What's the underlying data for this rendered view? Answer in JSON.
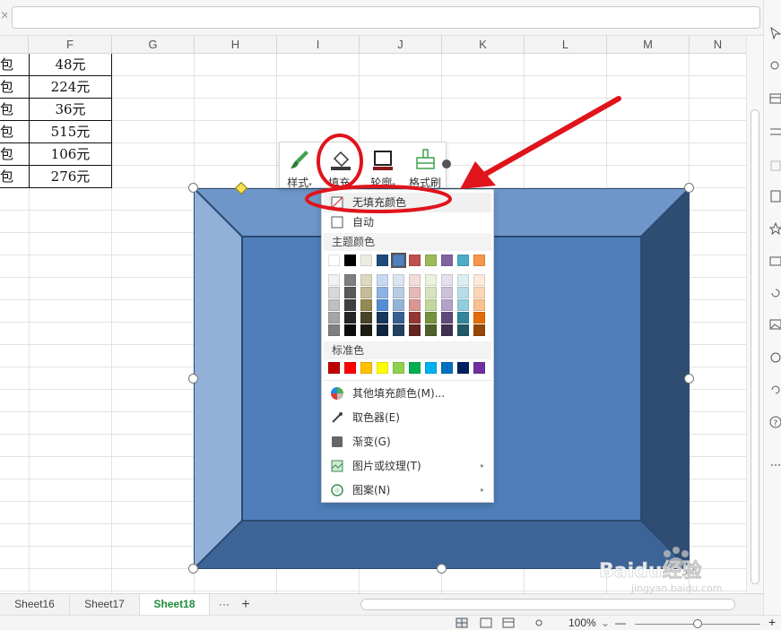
{
  "columns": [
    "F",
    "G",
    "H",
    "I",
    "J",
    "K",
    "L",
    "M",
    "N"
  ],
  "column_e_fragment": "包",
  "rows": [
    {
      "e": "包",
      "f": "48元"
    },
    {
      "e": "包",
      "f": "224元"
    },
    {
      "e": "包",
      "f": "36元"
    },
    {
      "e": "包",
      "f": "515元"
    },
    {
      "e": "包",
      "f": "106元"
    },
    {
      "e": "包",
      "f": "276元"
    }
  ],
  "shape_toolbar": {
    "style_label": "样式",
    "fill_label": "填充",
    "outline_label": "轮廓",
    "format_painter_label": "格式刷"
  },
  "fill_menu": {
    "no_fill": "无填充颜色",
    "auto": "自动",
    "theme_colors_title": "主题颜色",
    "standard_colors_title": "标准色",
    "more_colors": "其他填充颜色(M)...",
    "eyedropper": "取色器(E)",
    "gradient": "渐变(G)",
    "picture_texture": "图片或纹理(T)",
    "pattern": "图案(N)"
  },
  "theme_colors_top": [
    "#ffffff",
    "#000000",
    "#eeece1",
    "#1f497d",
    "#4f81bd",
    "#c0504d",
    "#9bbb59",
    "#8064a2",
    "#4bacc6",
    "#f79646"
  ],
  "theme_shades": [
    [
      "#f2f2f2",
      "#7f7f7f",
      "#ddd9c3",
      "#c6d9f0",
      "#dbe5f1",
      "#f2dcdb",
      "#ebf1dd",
      "#e5e0ec",
      "#dbeef3",
      "#fdeada"
    ],
    [
      "#d8d8d8",
      "#595959",
      "#c4bd97",
      "#8db3e2",
      "#b8cce4",
      "#e5b9b7",
      "#d7e3bc",
      "#ccc1d9",
      "#b7dde8",
      "#fbd5b5"
    ],
    [
      "#bfbfbf",
      "#3f3f3f",
      "#938953",
      "#548dd4",
      "#95b3d7",
      "#d99694",
      "#c3d69b",
      "#b2a2c7",
      "#92cddc",
      "#fac08f"
    ],
    [
      "#a5a5a5",
      "#262626",
      "#494429",
      "#17365d",
      "#366092",
      "#953734",
      "#76923c",
      "#5f497a",
      "#31859b",
      "#e36c09"
    ],
    [
      "#7f7f7f",
      "#0c0c0c",
      "#1d1b10",
      "#0f243e",
      "#244061",
      "#632423",
      "#4f6128",
      "#3f3151",
      "#205867",
      "#974806"
    ]
  ],
  "standard_colors": [
    "#c00000",
    "#ff0000",
    "#ffc000",
    "#ffff00",
    "#92d050",
    "#00b050",
    "#00b0f0",
    "#0070c0",
    "#002060",
    "#7030a0"
  ],
  "sheet_tabs": [
    "Sheet16",
    "Sheet17",
    "Sheet18"
  ],
  "active_sheet": "Sheet18",
  "tab_more": "···",
  "tab_add": "+",
  "zoom": "100%",
  "zoom_caret": "⌄",
  "zoom_minus": "—",
  "zoom_plus": "+",
  "watermark_text": "Baidu经验",
  "watermark_url": "jingyan.baidu.com",
  "colors": {
    "shape_face": "#4f7fba",
    "shape_top": "#6e96c8",
    "shape_left": "#93b1d8",
    "shape_right": "#2f4d72",
    "shape_bottom": "#3d6496",
    "annotation_red": "#e0141b",
    "active_tab": "#1e8c3a"
  }
}
